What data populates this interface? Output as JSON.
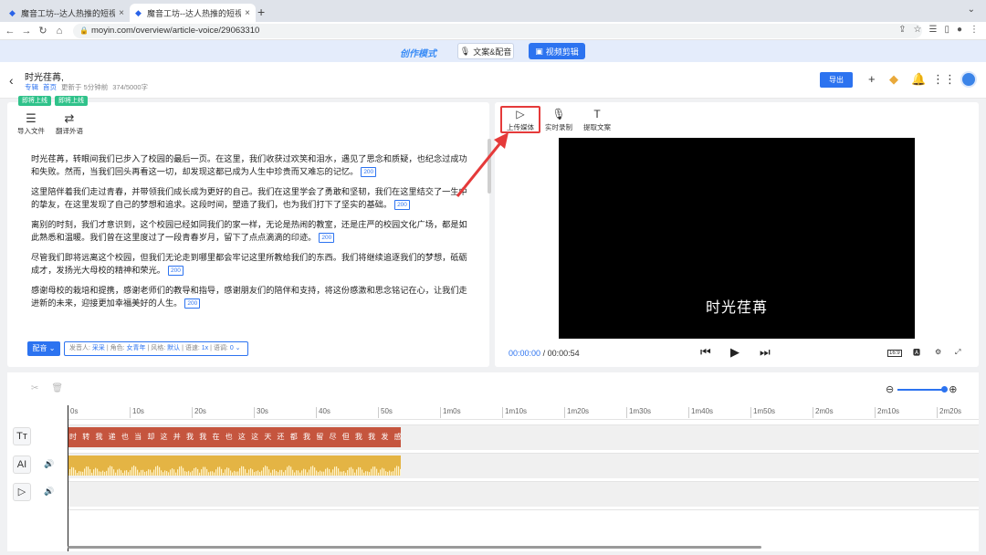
{
  "browser": {
    "tabs": [
      {
        "title": "魔音工坊--达人热推的短视频/有"
      },
      {
        "title": "魔音工坊--达人热推的短视频/有"
      }
    ],
    "url": "moyin.com/overview/article-voice/29063310"
  },
  "mode": {
    "logo": "创作模式",
    "btn_copy": "文案&配音",
    "btn_video": "视频剪辑"
  },
  "header": {
    "title": "时光荏苒,",
    "meta_a": "专辑",
    "meta_b": "首页",
    "meta_updated": "更新于 5分钟前",
    "meta_count": "374/5000字",
    "export": "导出"
  },
  "left": {
    "tags": [
      "即将上线",
      "即将上线"
    ],
    "tools": [
      {
        "label": "导入文件",
        "icon": "document-icon"
      },
      {
        "label": "翻译外语",
        "icon": "translate-icon"
      }
    ],
    "paragraphs": [
      {
        "text": "时光荏苒，转眼间我们已步入了校园的最后一页。在这里，我们收获过欢笑和泪水，遇见了思念和质疑，也纪念过成功和失败。然而，当我们回头再看这一切，却发现这都已成为人生中珍贵而又难忘的记忆。",
        "count": "200"
      },
      {
        "text": "这里陪伴着我们走过青春，并带领我们成长成为更好的自己。我们在这里学会了勇敢和坚韧，我们在这里结交了一生中的挚友，在这里发现了自己的梦想和追求。这段时间，塑造了我们，也为我们打下了坚实的基础。",
        "count": "200"
      },
      {
        "text": "离别的时刻，我们才意识到，这个校园已经如同我们的家一样，无论是热闹的教室，还是庄严的校园文化广场，都是如此熟悉和温暖。我们曾在这里度过了一段青春岁月，留下了点点滴滴的印迹。",
        "count": "200"
      },
      {
        "text": "尽管我们即将远离这个校园，但我们无论走到哪里都会牢记这里所教给我们的东西。我们将继续追逐我们的梦想，砥砺成才，发扬光大母校的精神和荣光。",
        "count": "200"
      },
      {
        "text": "感谢母校的栽培和提携，感谢老师们的教导和指导，感谢朋友们的陪伴和支持，将这份感激和思念铭记在心，让我们走进新的未来，迎接更加幸福美好的人生。",
        "count": "200"
      }
    ],
    "dub_label": "配音",
    "voice_prefix": "发音人:",
    "voice_name": "采采",
    "role_prefix": "| 角色:",
    "role": "女青年",
    "style_prefix": "| 风格:",
    "style": "默认",
    "speed_prefix": "| 语速:",
    "speed": "1x",
    "pitch_prefix": "| 语调:",
    "pitch": "0"
  },
  "right": {
    "tools": [
      {
        "label": "上传媒体",
        "icon": "upload-media-icon"
      },
      {
        "label": "实时录制",
        "icon": "microphone-icon"
      },
      {
        "label": "提取文案",
        "icon": "text-extract-icon"
      }
    ],
    "caption": "时光荏苒",
    "time_current": "00:00:00",
    "time_sep": "/",
    "time_total": "00:00:54",
    "aspect": "16:9"
  },
  "timeline": {
    "ticks": [
      "0s",
      "10s",
      "20s",
      "30s",
      "40s",
      "50s",
      "1m0s",
      "1m10s",
      "1m20s",
      "1m30s",
      "1m40s",
      "1m50s",
      "2m0s",
      "2m10s",
      "2m20s"
    ],
    "text_clip": "时 转 我 递 也 当 却 这 并 我 我 在 也 这 这 天 还 都 我 留 尽 但 我 我 发 感 感 感 将 让 迎",
    "track_labels": [
      "Tт",
      "AI"
    ],
    "colors": {
      "text_clip": "#c5553e",
      "audio_clip": "#e4b444",
      "accent": "#2c73f0"
    }
  }
}
